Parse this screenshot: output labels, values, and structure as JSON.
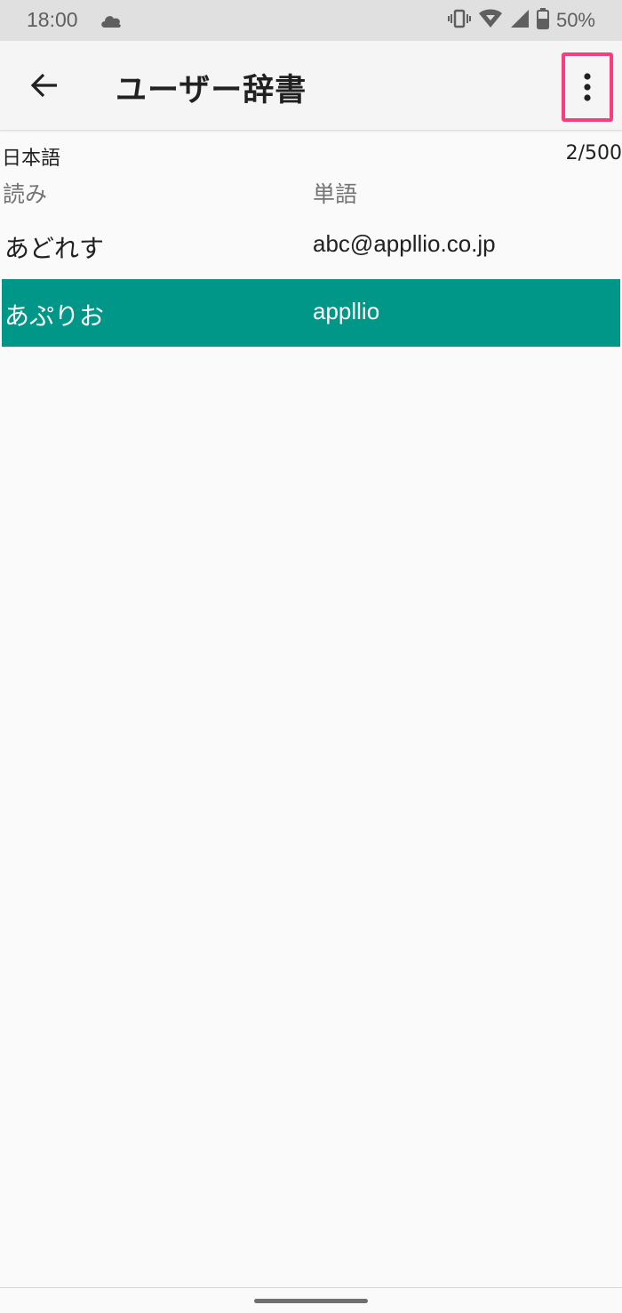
{
  "status_bar": {
    "time": "18:00",
    "battery": "50%",
    "icons": [
      "cloud-icon",
      "vibrate-icon",
      "wifi-icon",
      "cell-signal-icon",
      "battery-icon"
    ]
  },
  "app_bar": {
    "title": "ユーザー辞書",
    "back_icon": "arrow-left-icon",
    "menu_icon": "more-vert-icon"
  },
  "dictionary": {
    "language": "日本語",
    "count": "2/500",
    "columns": {
      "reading": "読み",
      "word": "単語"
    },
    "entries": [
      {
        "reading": "あどれす",
        "word": "abc@appllio.co.jp"
      },
      {
        "reading": "あぷりお",
        "word": "appllio"
      }
    ],
    "selected_index": 1
  },
  "colors": {
    "accent": "#009688",
    "highlight_box": "#ff3b7f"
  }
}
